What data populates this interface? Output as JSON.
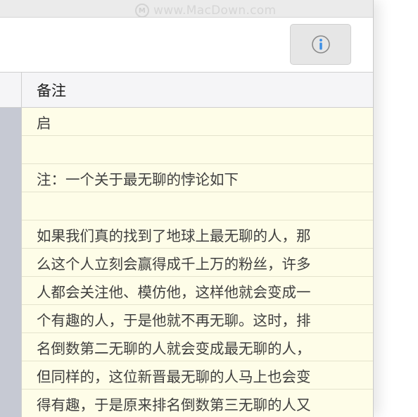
{
  "watermark": {
    "text": "www.MacDown.com",
    "logo_glyph": "M"
  },
  "toolbar": {
    "info_button_icon": "info-circle-icon"
  },
  "table": {
    "notes_header": "备注",
    "rows": [
      "启",
      "",
      "注：一个关于最无聊的悖论如下",
      "",
      "如果我们真的找到了地球上最无聊的人，那",
      "么这个人立刻会赢得成千上万的粉丝，许多",
      "人都会关注他、模仿他，这样他就会变成一",
      "个有趣的人，于是他就不再无聊。这时，排",
      "名倒数第二无聊的人就会变成最无聊的人，",
      "但同样的，这位新晋最无聊的人马上也会变",
      "得有趣，于是原来排名倒数第三无聊的人又"
    ]
  },
  "colors": {
    "notes_background": "#fefde8",
    "sidebar_column": "#c6c9d3",
    "info_icon_blue": "#3a8ee6"
  }
}
